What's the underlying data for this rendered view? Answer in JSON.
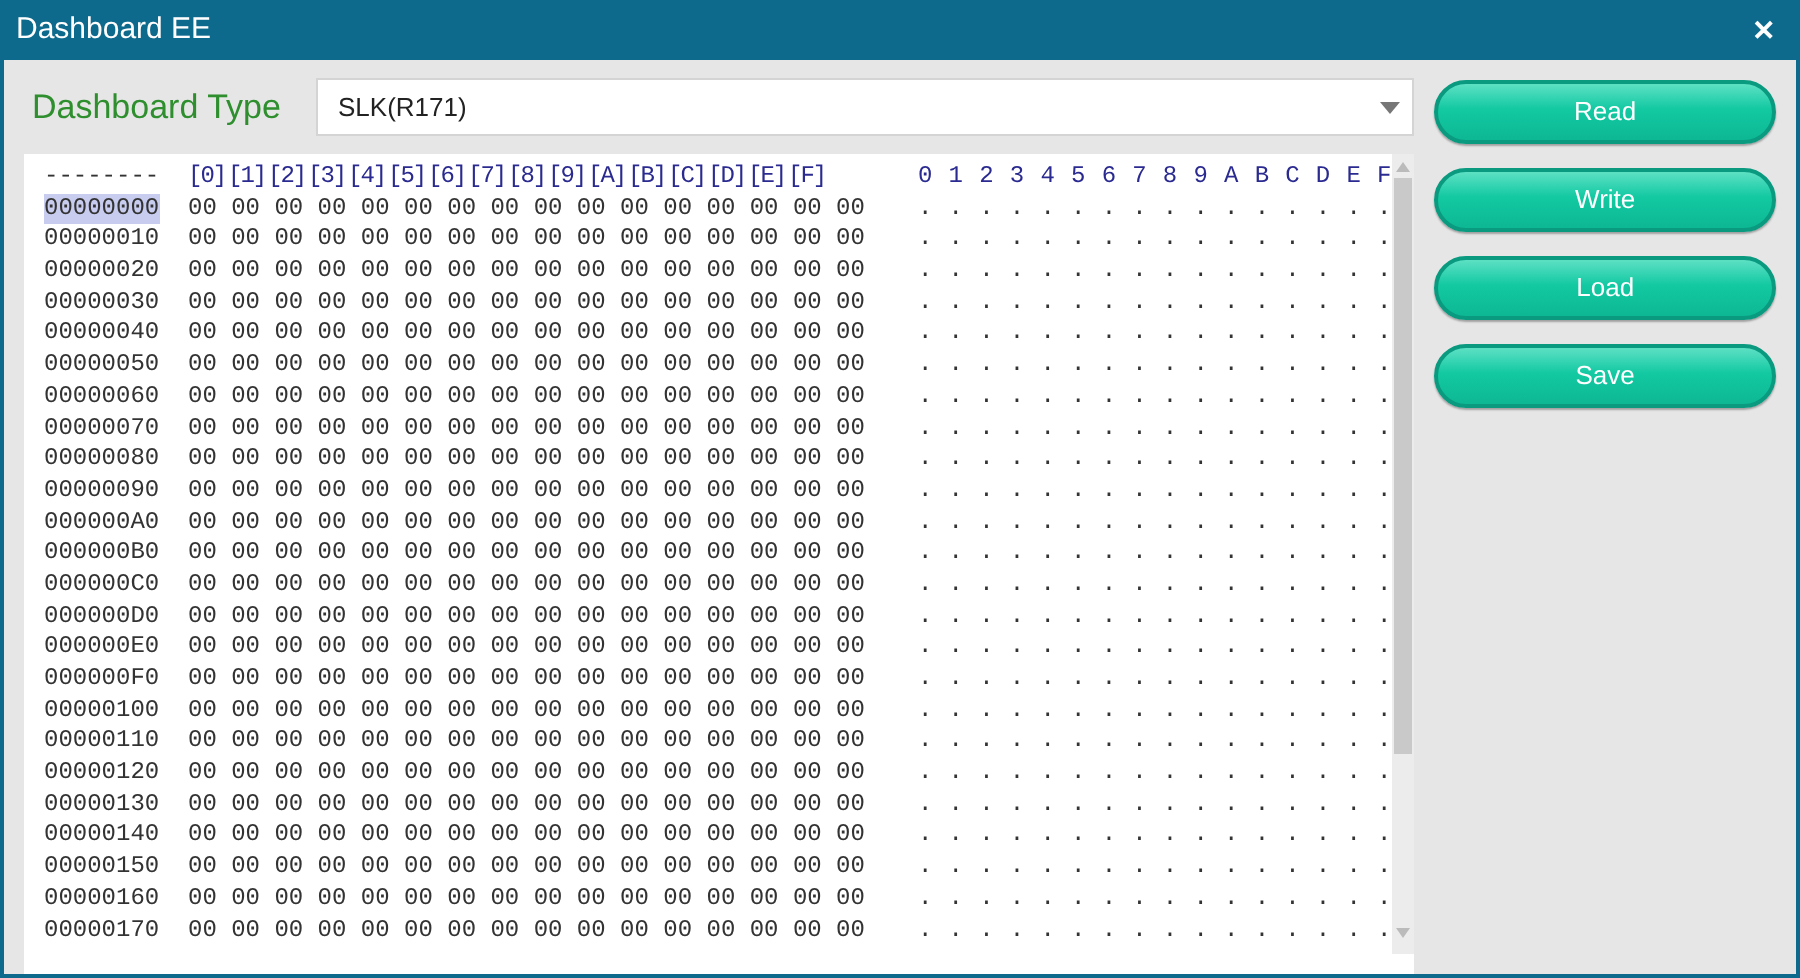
{
  "window": {
    "title": "Dashboard EE",
    "close": "✕"
  },
  "dashboard_type": {
    "label": "Dashboard Type",
    "value": "SLK(R171)"
  },
  "hex_view": {
    "address_header": "--------",
    "byte_headers": [
      "[0]",
      "[1]",
      "[2]",
      "[3]",
      "[4]",
      "[5]",
      "[6]",
      "[7]",
      "[8]",
      "[9]",
      "[A]",
      "[B]",
      "[C]",
      "[D]",
      "[E]",
      "[F]"
    ],
    "ascii_header": "0 1 2 3 4 5 6 7 8 9 A B C D E F",
    "rows": [
      {
        "address": "00000000",
        "selected": true,
        "bytes": "00 00 00 00 00 00 00 00 00 00 00 00 00 00 00 00",
        "ascii": ". . . . . . . . . . . . . . . ."
      },
      {
        "address": "00000010",
        "selected": false,
        "bytes": "00 00 00 00 00 00 00 00 00 00 00 00 00 00 00 00",
        "ascii": ". . . . . . . . . . . . . . . ."
      },
      {
        "address": "00000020",
        "selected": false,
        "bytes": "00 00 00 00 00 00 00 00 00 00 00 00 00 00 00 00",
        "ascii": ". . . . . . . . . . . . . . . ."
      },
      {
        "address": "00000030",
        "selected": false,
        "bytes": "00 00 00 00 00 00 00 00 00 00 00 00 00 00 00 00",
        "ascii": ". . . . . . . . . . . . . . . ."
      },
      {
        "address": "00000040",
        "selected": false,
        "bytes": "00 00 00 00 00 00 00 00 00 00 00 00 00 00 00 00",
        "ascii": ". . . . . . . . . . . . . . . ."
      },
      {
        "address": "00000050",
        "selected": false,
        "bytes": "00 00 00 00 00 00 00 00 00 00 00 00 00 00 00 00",
        "ascii": ". . . . . . . . . . . . . . . ."
      },
      {
        "address": "00000060",
        "selected": false,
        "bytes": "00 00 00 00 00 00 00 00 00 00 00 00 00 00 00 00",
        "ascii": ". . . . . . . . . . . . . . . ."
      },
      {
        "address": "00000070",
        "selected": false,
        "bytes": "00 00 00 00 00 00 00 00 00 00 00 00 00 00 00 00",
        "ascii": ". . . . . . . . . . . . . . . ."
      },
      {
        "address": "00000080",
        "selected": false,
        "bytes": "00 00 00 00 00 00 00 00 00 00 00 00 00 00 00 00",
        "ascii": ". . . . . . . . . . . . . . . ."
      },
      {
        "address": "00000090",
        "selected": false,
        "bytes": "00 00 00 00 00 00 00 00 00 00 00 00 00 00 00 00",
        "ascii": ". . . . . . . . . . . . . . . ."
      },
      {
        "address": "000000A0",
        "selected": false,
        "bytes": "00 00 00 00 00 00 00 00 00 00 00 00 00 00 00 00",
        "ascii": ". . . . . . . . . . . . . . . ."
      },
      {
        "address": "000000B0",
        "selected": false,
        "bytes": "00 00 00 00 00 00 00 00 00 00 00 00 00 00 00 00",
        "ascii": ". . . . . . . . . . . . . . . ."
      },
      {
        "address": "000000C0",
        "selected": false,
        "bytes": "00 00 00 00 00 00 00 00 00 00 00 00 00 00 00 00",
        "ascii": ". . . . . . . . . . . . . . . ."
      },
      {
        "address": "000000D0",
        "selected": false,
        "bytes": "00 00 00 00 00 00 00 00 00 00 00 00 00 00 00 00",
        "ascii": ". . . . . . . . . . . . . . . ."
      },
      {
        "address": "000000E0",
        "selected": false,
        "bytes": "00 00 00 00 00 00 00 00 00 00 00 00 00 00 00 00",
        "ascii": ". . . . . . . . . . . . . . . ."
      },
      {
        "address": "000000F0",
        "selected": false,
        "bytes": "00 00 00 00 00 00 00 00 00 00 00 00 00 00 00 00",
        "ascii": ". . . . . . . . . . . . . . . ."
      },
      {
        "address": "00000100",
        "selected": false,
        "bytes": "00 00 00 00 00 00 00 00 00 00 00 00 00 00 00 00",
        "ascii": ". . . . . . . . . . . . . . . ."
      },
      {
        "address": "00000110",
        "selected": false,
        "bytes": "00 00 00 00 00 00 00 00 00 00 00 00 00 00 00 00",
        "ascii": ". . . . . . . . . . . . . . . ."
      },
      {
        "address": "00000120",
        "selected": false,
        "bytes": "00 00 00 00 00 00 00 00 00 00 00 00 00 00 00 00",
        "ascii": ". . . . . . . . . . . . . . . ."
      },
      {
        "address": "00000130",
        "selected": false,
        "bytes": "00 00 00 00 00 00 00 00 00 00 00 00 00 00 00 00",
        "ascii": ". . . . . . . . . . . . . . . ."
      },
      {
        "address": "00000140",
        "selected": false,
        "bytes": "00 00 00 00 00 00 00 00 00 00 00 00 00 00 00 00",
        "ascii": ". . . . . . . . . . . . . . . ."
      },
      {
        "address": "00000150",
        "selected": false,
        "bytes": "00 00 00 00 00 00 00 00 00 00 00 00 00 00 00 00",
        "ascii": ". . . . . . . . . . . . . . . ."
      },
      {
        "address": "00000160",
        "selected": false,
        "bytes": "00 00 00 00 00 00 00 00 00 00 00 00 00 00 00 00",
        "ascii": ". . . . . . . . . . . . . . . ."
      },
      {
        "address": "00000170",
        "selected": false,
        "bytes": "00 00 00 00 00 00 00 00 00 00 00 00 00 00 00 00",
        "ascii": ". . . . . . . . . . . . . . . ."
      }
    ]
  },
  "buttons": [
    "Read",
    "Write",
    "Load",
    "Save"
  ]
}
